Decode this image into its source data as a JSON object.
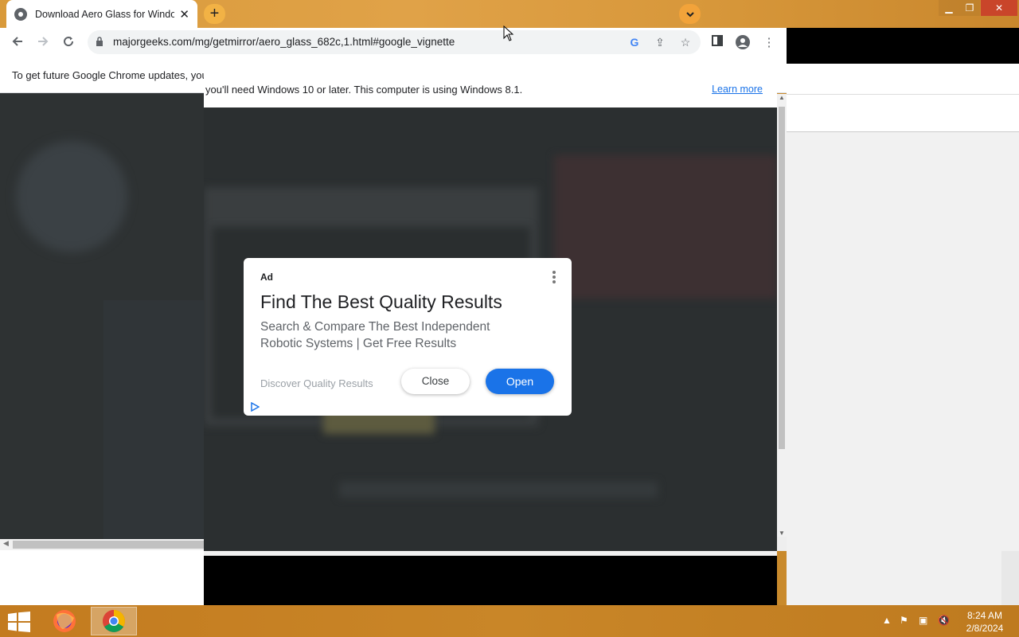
{
  "browser": {
    "tab_title": "Download Aero Glass for Windows",
    "new_tab_symbol": "+",
    "url": "majorgeeks.com/mg/getmirror/aero_glass_682c,1.html#google_vignette",
    "close_tab_symbol": "✕"
  },
  "window_controls": {
    "minimize": "▁",
    "restore": "❐",
    "close": "✕"
  },
  "infobar": {
    "text_part1": "To get future Google Chrome updates, you",
    "text_part2": "you'll need Windows 10 or later. This computer is using Windows 8.1.",
    "learn_more": "Learn more"
  },
  "ad": {
    "label": "Ad",
    "headline": "Find The Best Quality Results",
    "description": "Search & Compare The Best Independent Robotic Systems | Get Free Results",
    "display_url": "Discover Quality Results",
    "close_label": "Close",
    "open_label": "Open"
  },
  "taskbar": {
    "apps": [
      "start-button",
      "firefox",
      "chrome"
    ],
    "time": "8:24 AM",
    "date": "2/8/2024"
  },
  "colors": {
    "accent": "#1a73e8",
    "taskbar": "#c98628"
  }
}
